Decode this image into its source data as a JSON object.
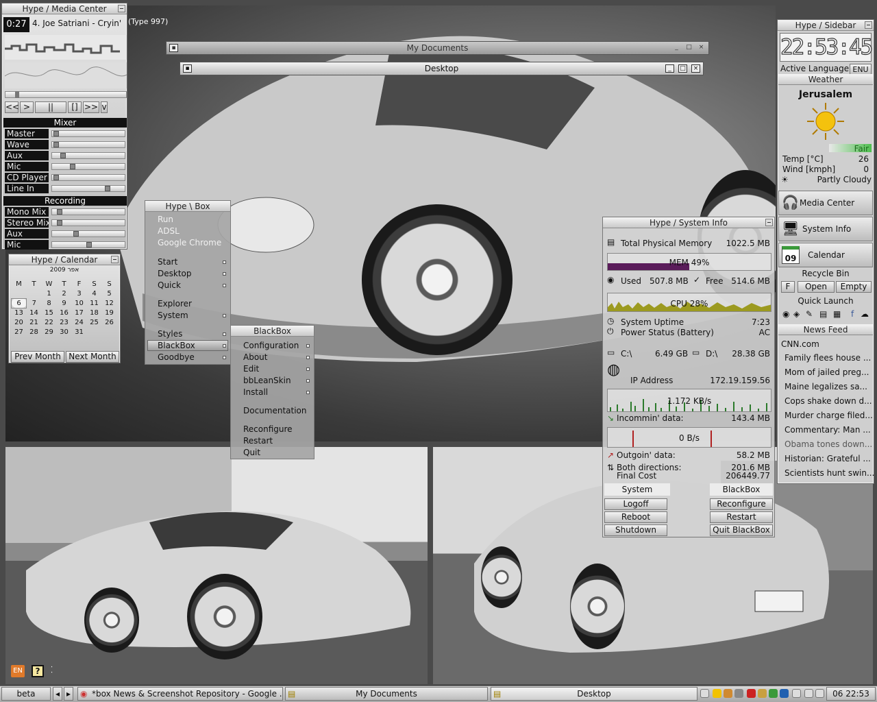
{
  "media_center": {
    "title": "Hype / Media Center",
    "time": "0:27",
    "track": "4. Joe Satriani - Cryin'",
    "type_label": "(Type 997)",
    "controls": [
      "<<",
      ">",
      "||",
      "[]",
      ">>",
      "v"
    ],
    "mixer_title": "Mixer",
    "channels": [
      {
        "label": "Master",
        "level": 0.0
      },
      {
        "label": "Wave",
        "level": 0.0
      },
      {
        "label": "Aux",
        "level": 0.1
      },
      {
        "label": "Mic",
        "level": 0.25
      },
      {
        "label": "CD Player",
        "level": 0.0
      },
      {
        "label": "Line In",
        "level": 0.78
      }
    ],
    "recording_title": "Recording",
    "rec_channels": [
      {
        "label": "Mono Mix",
        "level": 0.05
      },
      {
        "label": "Stereo Mix",
        "level": 0.05
      },
      {
        "label": "Aux",
        "level": 0.3
      },
      {
        "label": "Mic",
        "level": 0.5
      }
    ]
  },
  "calendar": {
    "title": "Hype / Calendar",
    "month_label": "2009 אפר",
    "weekdays": [
      "M",
      "T",
      "W",
      "T",
      "F",
      "S",
      "S"
    ],
    "weeks": [
      [
        "",
        "",
        "1",
        "2",
        "3",
        "4",
        "5"
      ],
      [
        "6",
        "7",
        "8",
        "9",
        "10",
        "11",
        "12"
      ],
      [
        "13",
        "14",
        "15",
        "16",
        "17",
        "18",
        "19"
      ],
      [
        "20",
        "21",
        "22",
        "23",
        "24",
        "25",
        "26"
      ],
      [
        "27",
        "28",
        "29",
        "30",
        "31",
        "",
        ""
      ]
    ],
    "today": "6",
    "prev": "Prev Month",
    "next": "Next Month"
  },
  "windows": {
    "my_documents": "My Documents",
    "desktop": "Desktop"
  },
  "box_menu": {
    "title": "Hype \\ Box",
    "items": [
      {
        "label": "Run",
        "dim": true
      },
      {
        "label": "ADSL",
        "dim": true
      },
      {
        "label": "Google Chrome",
        "dim": true
      },
      {
        "label": "Start",
        "sub": true
      },
      {
        "label": "Desktop",
        "sub": true
      },
      {
        "label": "Quick",
        "sub": true
      },
      {
        "label": "Explorer"
      },
      {
        "label": "System",
        "sub": true
      },
      {
        "label": "Styles",
        "sub": true
      },
      {
        "label": "BlackBox",
        "sub": true,
        "selected": true
      },
      {
        "label": "Goodbye",
        "sub": true
      }
    ]
  },
  "blackbox_menu": {
    "title": "BlackBox",
    "items": [
      {
        "label": "Configuration",
        "sub": true
      },
      {
        "label": "About",
        "sub": true
      },
      {
        "label": "Edit",
        "sub": true
      },
      {
        "label": "bbLeanSkin",
        "sub": true
      },
      {
        "label": "Install",
        "sub": true
      },
      {
        "label": "Documentation"
      },
      {
        "label": "Reconfigure"
      },
      {
        "label": "Restart"
      },
      {
        "label": "Quit"
      }
    ]
  },
  "sysinfo": {
    "title": "Hype / System Info",
    "total_mem_label": "Total Physical Memory",
    "total_mem": "1022.5 MB",
    "mem_bar": "MEM 49%",
    "mem_percent": 49,
    "used_label": "Used",
    "used": "507.8 MB",
    "free_label": "Free",
    "free": "514.6 MB",
    "cpu_bar": "CPU 28%",
    "uptime_label": "System Uptime",
    "uptime": "7:23",
    "power_label": "Power Status (Battery)",
    "power": "AC",
    "c_label": "C:\\",
    "c_free": "6.49 GB",
    "d_label": "D:\\",
    "d_free": "28.38 GB",
    "ip_label": "IP Address",
    "ip": "172.19.159.56",
    "in_rate": "1.172 KB/s",
    "in_label": "Incommin' data:",
    "in_total": "143.4 MB",
    "out_rate": "0 B/s",
    "out_label": "Outgoin' data:",
    "out_total": "58.2 MB",
    "both_label": "Both directions:",
    "both_total": "201.6 MB",
    "cost_label": "Final Cost",
    "cost": "206449.77",
    "system_label": "System",
    "blackbox_label": "BlackBox",
    "buttons_left": [
      "Logoff",
      "Reboot",
      "Shutdown"
    ],
    "buttons_right": [
      "Reconfigure",
      "Restart",
      "Quit BlackBox"
    ]
  },
  "sidebar": {
    "title": "Hype / Sidebar",
    "clock": "22:53:45",
    "lang_label": "Active Language:",
    "lang": "ENU",
    "weather_title": "Weather",
    "city": "Jerusalem",
    "condition": "Fair",
    "temp_label": "Temp [°C]",
    "temp": "26",
    "wind_label": "Wind [kmph]",
    "wind": "0",
    "sky": "Partly Cloudy",
    "media_center": "Media Center",
    "system_info": "System Info",
    "calendar": "Calendar",
    "calendar_day": "09",
    "recycle_title": "Recycle Bin",
    "recycle_f": "F",
    "open": "Open",
    "empty": "Empty",
    "quick_launch": "Quick Launch",
    "news_title": "News Feed",
    "news_source": "CNN.com",
    "news": [
      "Family flees house ...",
      "Mom of jailed preg...",
      "Maine legalizes sa...",
      "Cops shake down d...",
      "Murder charge filed...",
      "Commentary: Man ...",
      "Obama tones down...",
      "Historian: Grateful ...",
      "Scientists hunt swin..."
    ]
  },
  "taskbar": {
    "workspace": "beta",
    "task1": "*box News & Screenshot Repository - Google ...",
    "task2": "My Documents",
    "task3": "Desktop",
    "clock": "06 22:53",
    "lang": "EN",
    "help": "?"
  },
  "colors": {
    "panel": "#d0d0d0",
    "mem_fill": "#5a1c5a",
    "graph": "#9c9a20",
    "accent": "#e07a2a"
  }
}
